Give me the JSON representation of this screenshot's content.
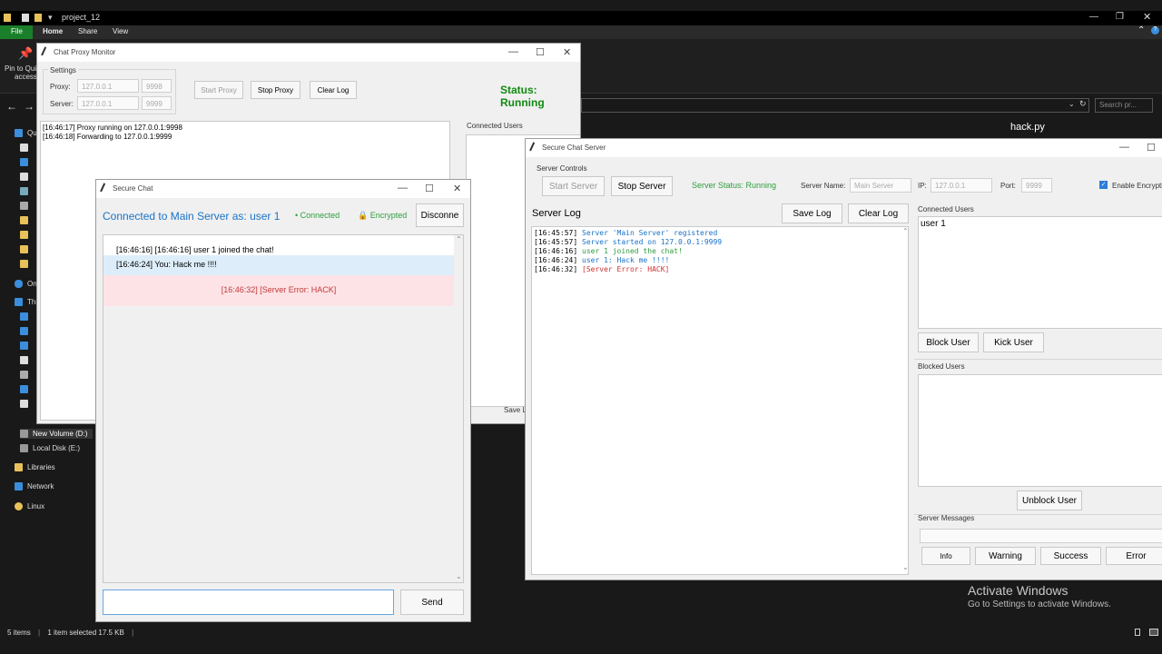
{
  "explorer": {
    "title": "project_12",
    "ribbon_tabs": [
      "File",
      "Home",
      "Share",
      "View"
    ],
    "pin_label": "Pin to Quick access",
    "pin_label_1": "Pin to Qui",
    "pin_label_2": "access",
    "search_placeholder": "Search pr...",
    "file_name": "hack.py",
    "nav": {
      "new_volume": "New Volume (D:)",
      "local_disk": "Local Disk (E:)",
      "libraries": "Libraries",
      "network": "Network",
      "linux": "Linux"
    },
    "status": {
      "items": "5 items",
      "selected": "1 item selected  17.5 KB"
    },
    "activate_title": "Activate Windows",
    "activate_sub": "Go to Settings to activate Windows."
  },
  "proxy": {
    "title": "Chat Proxy Monitor",
    "settings_label": "Settings",
    "proxy_label": "Proxy:",
    "server_label": "Server:",
    "proxy_ip": "127.0.0.1",
    "proxy_port": "9998",
    "server_ip": "127.0.0.1",
    "server_port": "9999",
    "start_button": "Start Proxy",
    "stop_button": "Stop Proxy",
    "clear_button": "Clear Log",
    "status": "Status: Running",
    "log": [
      "[16:46:17] Proxy running on 127.0.0.1:9998",
      "[16:46:18] Forwarding to 127.0.0.1:9999"
    ],
    "connected_users_label": "Connected Users",
    "save_label": "Save Lo"
  },
  "chat": {
    "title": "Secure Chat",
    "connected_text": "Connected to Main Server as: user 1",
    "status_connected": "• Connected",
    "status_encrypted": "Encrypted",
    "disconnect_button": "Disconne",
    "messages": [
      {
        "text": "[16:46:16] [16:46:16] user 1 joined the chat!"
      },
      {
        "text": "[16:46:24] You: Hack me !!!!"
      },
      {
        "text": "[16:46:32] [Server Error: HACK]"
      }
    ],
    "input_value": "",
    "send_button": "Send"
  },
  "server": {
    "title": "Secure Chat Server",
    "controls_label": "Server Controls",
    "start_button": "Start Server",
    "stop_button": "Stop Server",
    "server_status": "Server Status: Running",
    "server_name_label": "Server Name:",
    "server_name_placeholder": "Main Server",
    "ip_label": "IP:",
    "ip_placeholder": "127.0.0.1",
    "port_label": "Port:",
    "port_placeholder": "9999",
    "encrypt_label": "Enable Encrypti",
    "log_title": "Server Log",
    "save_log": "Save Log",
    "clear_log": "Clear Log",
    "log": [
      {
        "time": "[16:45:57]",
        "text": "Server 'Main Server' registered",
        "color": "#1a73c8"
      },
      {
        "time": "[16:45:57]",
        "text": "Server started on 127.0.0.1:9999",
        "color": "#1a73c8"
      },
      {
        "time": "[16:46:16]",
        "text": "user 1 joined the chat!",
        "color": "#2e9e3e"
      },
      {
        "time": "[16:46:24]",
        "text": "user 1: Hack me !!!!",
        "color": "#1a73c8"
      },
      {
        "time": "[16:46:32]",
        "text": "[Server Error: HACK]",
        "color": "#d03030"
      }
    ],
    "connected_users_label": "Connected Users",
    "connected_users": [
      "user 1"
    ],
    "block_button": "Block User",
    "kick_button": "Kick User",
    "blocked_users_label": "Blocked Users",
    "unblock_button": "Unblock User",
    "server_messages_label": "Server Messages",
    "msg_info": "Info",
    "msg_warning": "Warning",
    "msg_success": "Success",
    "msg_error": "Error"
  },
  "colors": {
    "accent_blue": "#1a73c8",
    "green": "#2e9e3e",
    "red": "#d03030",
    "status_green": "#128a12"
  }
}
